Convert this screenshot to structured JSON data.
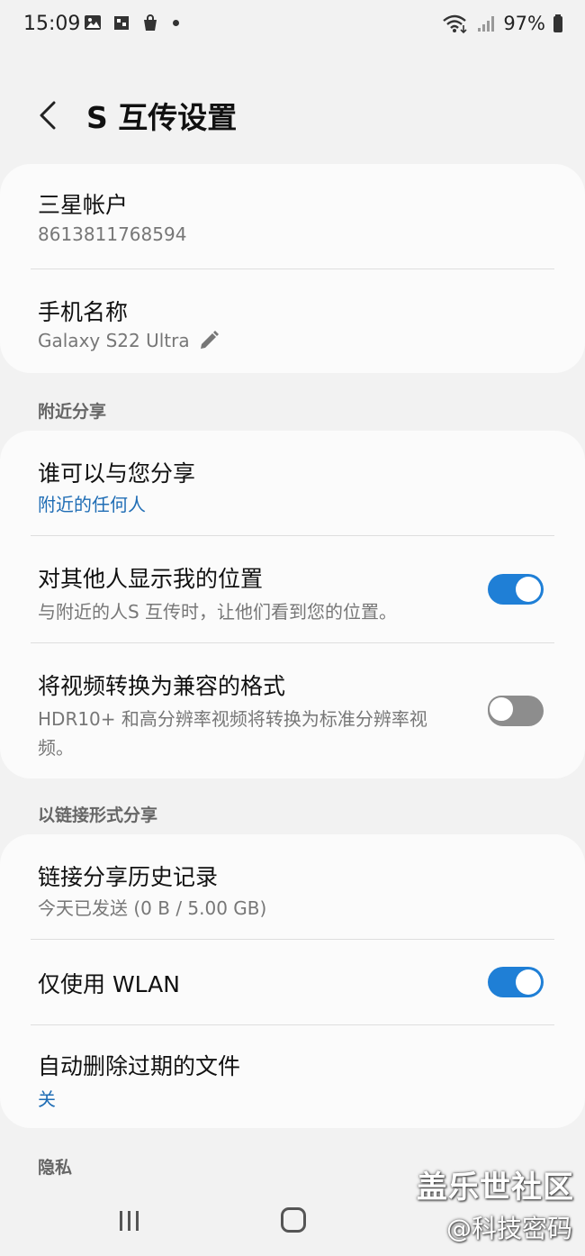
{
  "status_bar": {
    "time": "15:09",
    "battery": "97%",
    "icons": [
      "gallery-icon",
      "game-icon",
      "shop-bag-icon",
      "notification-dot",
      "wifi-icon",
      "signal-icon",
      "battery-icon"
    ]
  },
  "header": {
    "title": "S 互传设置"
  },
  "account": {
    "samsung_account_title": "三星帐户",
    "samsung_account_value": "8613811768594",
    "phone_name_title": "手机名称",
    "phone_name_value": "Galaxy S22 Ultra"
  },
  "nearby_share": {
    "section_label": "附近分享",
    "who_can_share_title": "谁可以与您分享",
    "who_can_share_value": "附近的任何人",
    "show_location_title": "对其他人显示我的位置",
    "show_location_desc": "与附近的人S 互传时，让他们看到您的位置。",
    "show_location_on": true,
    "convert_video_title": "将视频转换为兼容的格式",
    "convert_video_desc_line1": "HDR10+ 和高分辨率视频将转换为标准分辨率视",
    "convert_video_desc_line2": "频。",
    "convert_video_on": false
  },
  "link_share": {
    "section_label": "以链接形式分享",
    "history_title": "链接分享历史记录",
    "history_value": "今天已发送 (0 B / 5.00 GB)",
    "wlan_only_title": "仅使用 WLAN",
    "wlan_only_on": true,
    "auto_delete_title": "自动删除过期的文件",
    "auto_delete_value": "关"
  },
  "privacy": {
    "section_label": "隐私"
  },
  "watermark": {
    "line1": "盖乐世社区",
    "line2": "@科技密码"
  },
  "colors": {
    "accent": "#1f7fd6",
    "background": "#f2f2f2",
    "card": "#fbfbfb",
    "link_text": "#1f6db5"
  }
}
